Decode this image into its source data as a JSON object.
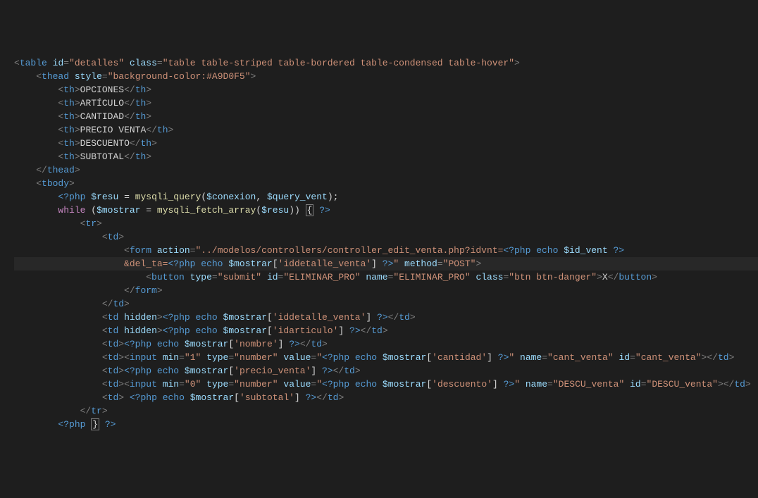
{
  "lines": [
    [
      [
        "tag-bracket",
        "<"
      ],
      [
        "tag-name",
        "table"
      ],
      [
        "text",
        " "
      ],
      [
        "attr-name",
        "id"
      ],
      [
        "tag-bracket",
        "="
      ],
      [
        "attr-value",
        "\"detalles\""
      ],
      [
        "text",
        " "
      ],
      [
        "attr-name",
        "class"
      ],
      [
        "tag-bracket",
        "="
      ],
      [
        "attr-value",
        "\"table table-striped table-bordered table-condensed table-hover\""
      ],
      [
        "tag-bracket",
        ">"
      ]
    ],
    [
      [
        "text",
        "    "
      ],
      [
        "tag-bracket",
        "<"
      ],
      [
        "tag-name",
        "thead"
      ],
      [
        "text",
        " "
      ],
      [
        "attr-name",
        "style"
      ],
      [
        "tag-bracket",
        "="
      ],
      [
        "attr-value",
        "\"background-color:#A9D0F5\""
      ],
      [
        "tag-bracket",
        ">"
      ]
    ],
    [
      [
        "text",
        "        "
      ],
      [
        "tag-bracket",
        "<"
      ],
      [
        "tag-name",
        "th"
      ],
      [
        "tag-bracket",
        ">"
      ],
      [
        "text",
        "OPCIONES"
      ],
      [
        "tag-bracket",
        "</"
      ],
      [
        "tag-name",
        "th"
      ],
      [
        "tag-bracket",
        ">"
      ]
    ],
    [
      [
        "text",
        "        "
      ],
      [
        "tag-bracket",
        "<"
      ],
      [
        "tag-name",
        "th"
      ],
      [
        "tag-bracket",
        ">"
      ],
      [
        "text",
        "ARTÍCULO"
      ],
      [
        "tag-bracket",
        "</"
      ],
      [
        "tag-name",
        "th"
      ],
      [
        "tag-bracket",
        ">"
      ]
    ],
    [
      [
        "text",
        "        "
      ],
      [
        "tag-bracket",
        "<"
      ],
      [
        "tag-name",
        "th"
      ],
      [
        "tag-bracket",
        ">"
      ],
      [
        "text",
        "CANTIDAD"
      ],
      [
        "tag-bracket",
        "</"
      ],
      [
        "tag-name",
        "th"
      ],
      [
        "tag-bracket",
        ">"
      ]
    ],
    [
      [
        "text",
        "        "
      ],
      [
        "tag-bracket",
        "<"
      ],
      [
        "tag-name",
        "th"
      ],
      [
        "tag-bracket",
        ">"
      ],
      [
        "text",
        "PRECIO VENTA"
      ],
      [
        "tag-bracket",
        "</"
      ],
      [
        "tag-name",
        "th"
      ],
      [
        "tag-bracket",
        ">"
      ]
    ],
    [
      [
        "text",
        "        "
      ],
      [
        "tag-bracket",
        "<"
      ],
      [
        "tag-name",
        "th"
      ],
      [
        "tag-bracket",
        ">"
      ],
      [
        "text",
        "DESCUENTO"
      ],
      [
        "tag-bracket",
        "</"
      ],
      [
        "tag-name",
        "th"
      ],
      [
        "tag-bracket",
        ">"
      ]
    ],
    [
      [
        "text",
        "        "
      ],
      [
        "tag-bracket",
        "<"
      ],
      [
        "tag-name",
        "th"
      ],
      [
        "tag-bracket",
        ">"
      ],
      [
        "text",
        "SUBTOTAL"
      ],
      [
        "tag-bracket",
        "</"
      ],
      [
        "tag-name",
        "th"
      ],
      [
        "tag-bracket",
        ">"
      ]
    ],
    [
      [
        "text",
        "    "
      ],
      [
        "tag-bracket",
        "</"
      ],
      [
        "tag-name",
        "thead"
      ],
      [
        "tag-bracket",
        ">"
      ]
    ],
    [
      [
        "text",
        "    "
      ],
      [
        "tag-bracket",
        "<"
      ],
      [
        "tag-name",
        "tbody"
      ],
      [
        "tag-bracket",
        ">"
      ]
    ],
    [
      [
        "text",
        "        "
      ],
      [
        "php-tag",
        "<?php"
      ],
      [
        "text",
        " "
      ],
      [
        "php-var",
        "$resu"
      ],
      [
        "text",
        " "
      ],
      [
        "php-op",
        "="
      ],
      [
        "text",
        " "
      ],
      [
        "php-fn",
        "mysqli_query"
      ],
      [
        "php-op",
        "("
      ],
      [
        "php-var",
        "$conexion"
      ],
      [
        "php-op",
        ","
      ],
      [
        "text",
        " "
      ],
      [
        "php-var",
        "$query_vent"
      ],
      [
        "php-op",
        ")"
      ],
      [
        "php-op",
        ";"
      ]
    ],
    [
      [
        "text",
        "        "
      ],
      [
        "php-kw",
        "while"
      ],
      [
        "text",
        " "
      ],
      [
        "php-op",
        "("
      ],
      [
        "php-var",
        "$mostrar"
      ],
      [
        "text",
        " "
      ],
      [
        "php-op",
        "="
      ],
      [
        "text",
        " "
      ],
      [
        "php-fn",
        "mysqli_fetch_array"
      ],
      [
        "php-op",
        "("
      ],
      [
        "php-var",
        "$resu"
      ],
      [
        "php-op",
        "))"
      ],
      [
        "text",
        " "
      ],
      [
        "brace-box",
        "{"
      ],
      [
        "text",
        " "
      ],
      [
        "php-tag",
        "?>"
      ]
    ],
    [
      [
        "text",
        "            "
      ],
      [
        "tag-bracket",
        "<"
      ],
      [
        "tag-name",
        "tr"
      ],
      [
        "tag-bracket",
        ">"
      ]
    ],
    [
      [
        "text",
        "                "
      ],
      [
        "tag-bracket",
        "<"
      ],
      [
        "tag-name",
        "td"
      ],
      [
        "tag-bracket",
        ">"
      ]
    ],
    [
      [
        "text",
        "                    "
      ],
      [
        "tag-bracket",
        "<"
      ],
      [
        "tag-name",
        "form"
      ],
      [
        "text",
        " "
      ],
      [
        "attr-name",
        "action"
      ],
      [
        "tag-bracket",
        "="
      ],
      [
        "attr-value",
        "\"../modelos/controllers/controller_edit_venta.php?idvnt="
      ],
      [
        "php-tag",
        "<?php"
      ],
      [
        "text",
        " "
      ],
      [
        "php-kw2",
        "echo"
      ],
      [
        "text",
        " "
      ],
      [
        "php-var",
        "$id_vent"
      ],
      [
        "text",
        " "
      ],
      [
        "php-tag",
        "?>"
      ]
    ],
    [
      [
        "text",
        "                    "
      ],
      [
        "attr-value",
        "&del_ta="
      ],
      [
        "php-tag",
        "<?php"
      ],
      [
        "text",
        " "
      ],
      [
        "php-kw2",
        "echo"
      ],
      [
        "text",
        " "
      ],
      [
        "php-var",
        "$mostrar"
      ],
      [
        "php-op",
        "["
      ],
      [
        "php-str",
        "'iddetalle_venta'"
      ],
      [
        "php-op",
        "]"
      ],
      [
        "text",
        " "
      ],
      [
        "php-tag",
        "?>"
      ],
      [
        "attr-value",
        "\""
      ],
      [
        "text",
        " "
      ],
      [
        "attr-name",
        "method"
      ],
      [
        "tag-bracket",
        "="
      ],
      [
        "attr-value",
        "\"POST\""
      ],
      [
        "tag-bracket",
        ">"
      ]
    ],
    [
      [
        "text",
        "                        "
      ],
      [
        "tag-bracket",
        "<"
      ],
      [
        "tag-name",
        "button"
      ],
      [
        "text",
        " "
      ],
      [
        "attr-name",
        "type"
      ],
      [
        "tag-bracket",
        "="
      ],
      [
        "attr-value",
        "\"submit\""
      ],
      [
        "text",
        " "
      ],
      [
        "attr-name",
        "id"
      ],
      [
        "tag-bracket",
        "="
      ],
      [
        "attr-value",
        "\"ELIMINAR_PRO\""
      ],
      [
        "text",
        " "
      ],
      [
        "attr-name",
        "name"
      ],
      [
        "tag-bracket",
        "="
      ],
      [
        "attr-value",
        "\"ELIMINAR_PRO\""
      ],
      [
        "text",
        " "
      ],
      [
        "attr-name",
        "class"
      ],
      [
        "tag-bracket",
        "="
      ],
      [
        "attr-value",
        "\"btn btn-danger\""
      ],
      [
        "tag-bracket",
        ">"
      ],
      [
        "text",
        "X"
      ],
      [
        "tag-bracket",
        "</"
      ],
      [
        "tag-name",
        "button"
      ],
      [
        "tag-bracket",
        ">"
      ]
    ],
    [
      [
        "text",
        "                    "
      ],
      [
        "tag-bracket",
        "</"
      ],
      [
        "tag-name",
        "form"
      ],
      [
        "tag-bracket",
        ">"
      ]
    ],
    [
      [
        "text",
        "                "
      ],
      [
        "tag-bracket",
        "</"
      ],
      [
        "tag-name",
        "td"
      ],
      [
        "tag-bracket",
        ">"
      ]
    ],
    [
      [
        "text",
        "                "
      ],
      [
        "tag-bracket",
        "<"
      ],
      [
        "tag-name",
        "td"
      ],
      [
        "text",
        " "
      ],
      [
        "attr-name",
        "hidden"
      ],
      [
        "tag-bracket",
        ">"
      ],
      [
        "php-tag",
        "<?php"
      ],
      [
        "text",
        " "
      ],
      [
        "php-kw2",
        "echo"
      ],
      [
        "text",
        " "
      ],
      [
        "php-var",
        "$mostrar"
      ],
      [
        "php-op",
        "["
      ],
      [
        "php-str",
        "'iddetalle_venta'"
      ],
      [
        "php-op",
        "]"
      ],
      [
        "text",
        " "
      ],
      [
        "php-tag",
        "?>"
      ],
      [
        "tag-bracket",
        "</"
      ],
      [
        "tag-name",
        "td"
      ],
      [
        "tag-bracket",
        ">"
      ]
    ],
    [
      [
        "text",
        "                "
      ],
      [
        "tag-bracket",
        "<"
      ],
      [
        "tag-name",
        "td"
      ],
      [
        "text",
        " "
      ],
      [
        "attr-name",
        "hidden"
      ],
      [
        "tag-bracket",
        ">"
      ],
      [
        "php-tag",
        "<?php"
      ],
      [
        "text",
        " "
      ],
      [
        "php-kw2",
        "echo"
      ],
      [
        "text",
        " "
      ],
      [
        "php-var",
        "$mostrar"
      ],
      [
        "php-op",
        "["
      ],
      [
        "php-str",
        "'idarticulo'"
      ],
      [
        "php-op",
        "]"
      ],
      [
        "text",
        " "
      ],
      [
        "php-tag",
        "?>"
      ],
      [
        "tag-bracket",
        "</"
      ],
      [
        "tag-name",
        "td"
      ],
      [
        "tag-bracket",
        ">"
      ]
    ],
    [
      [
        "text",
        "                "
      ],
      [
        "tag-bracket",
        "<"
      ],
      [
        "tag-name",
        "td"
      ],
      [
        "tag-bracket",
        ">"
      ],
      [
        "php-tag",
        "<?php"
      ],
      [
        "text",
        " "
      ],
      [
        "php-kw2",
        "echo"
      ],
      [
        "text",
        " "
      ],
      [
        "php-var",
        "$mostrar"
      ],
      [
        "php-op",
        "["
      ],
      [
        "php-str",
        "'nombre'"
      ],
      [
        "php-op",
        "]"
      ],
      [
        "text",
        " "
      ],
      [
        "php-tag",
        "?>"
      ],
      [
        "tag-bracket",
        "</"
      ],
      [
        "tag-name",
        "td"
      ],
      [
        "tag-bracket",
        ">"
      ]
    ],
    [
      [
        "text",
        "                "
      ],
      [
        "tag-bracket",
        "<"
      ],
      [
        "tag-name",
        "td"
      ],
      [
        "tag-bracket",
        ">"
      ],
      [
        "tag-bracket",
        "<"
      ],
      [
        "tag-name",
        "input"
      ],
      [
        "text",
        " "
      ],
      [
        "attr-name",
        "min"
      ],
      [
        "tag-bracket",
        "="
      ],
      [
        "attr-value",
        "\"1\""
      ],
      [
        "text",
        " "
      ],
      [
        "attr-name",
        "type"
      ],
      [
        "tag-bracket",
        "="
      ],
      [
        "attr-value",
        "\"number\""
      ],
      [
        "text",
        " "
      ],
      [
        "attr-name",
        "value"
      ],
      [
        "tag-bracket",
        "="
      ],
      [
        "attr-value",
        "\""
      ],
      [
        "php-tag",
        "<?php"
      ],
      [
        "text",
        " "
      ],
      [
        "php-kw2",
        "echo"
      ],
      [
        "text",
        " "
      ],
      [
        "php-var",
        "$mostrar"
      ],
      [
        "php-op",
        "["
      ],
      [
        "php-str",
        "'cantidad'"
      ],
      [
        "php-op",
        "]"
      ],
      [
        "text",
        " "
      ],
      [
        "php-tag",
        "?>"
      ],
      [
        "attr-value",
        "\""
      ],
      [
        "text",
        " "
      ],
      [
        "attr-name",
        "name"
      ],
      [
        "tag-bracket",
        "="
      ],
      [
        "attr-value",
        "\"cant_venta\""
      ],
      [
        "text",
        " "
      ],
      [
        "attr-name",
        "id"
      ],
      [
        "tag-bracket",
        "="
      ],
      [
        "attr-value",
        "\"cant_venta\""
      ],
      [
        "tag-bracket",
        ">"
      ],
      [
        "tag-bracket",
        "</"
      ],
      [
        "tag-name",
        "td"
      ],
      [
        "tag-bracket",
        ">"
      ]
    ],
    [
      [
        "text",
        "                "
      ],
      [
        "tag-bracket",
        "<"
      ],
      [
        "tag-name",
        "td"
      ],
      [
        "tag-bracket",
        ">"
      ],
      [
        "php-tag",
        "<?php"
      ],
      [
        "text",
        " "
      ],
      [
        "php-kw2",
        "echo"
      ],
      [
        "text",
        " "
      ],
      [
        "php-var",
        "$mostrar"
      ],
      [
        "php-op",
        "["
      ],
      [
        "php-str",
        "'precio_venta'"
      ],
      [
        "php-op",
        "]"
      ],
      [
        "text",
        " "
      ],
      [
        "php-tag",
        "?>"
      ],
      [
        "tag-bracket",
        "</"
      ],
      [
        "tag-name",
        "td"
      ],
      [
        "tag-bracket",
        ">"
      ]
    ],
    [
      [
        "text",
        "                "
      ],
      [
        "tag-bracket",
        "<"
      ],
      [
        "tag-name",
        "td"
      ],
      [
        "tag-bracket",
        ">"
      ],
      [
        "tag-bracket",
        "<"
      ],
      [
        "tag-name",
        "input"
      ],
      [
        "text",
        " "
      ],
      [
        "attr-name",
        "min"
      ],
      [
        "tag-bracket",
        "="
      ],
      [
        "attr-value",
        "\"0\""
      ],
      [
        "text",
        " "
      ],
      [
        "attr-name",
        "type"
      ],
      [
        "tag-bracket",
        "="
      ],
      [
        "attr-value",
        "\"number\""
      ],
      [
        "text",
        " "
      ],
      [
        "attr-name",
        "value"
      ],
      [
        "tag-bracket",
        "="
      ],
      [
        "attr-value",
        "\""
      ],
      [
        "php-tag",
        "<?php"
      ],
      [
        "text",
        " "
      ],
      [
        "php-kw2",
        "echo"
      ],
      [
        "text",
        " "
      ],
      [
        "php-var",
        "$mostrar"
      ],
      [
        "php-op",
        "["
      ],
      [
        "php-str",
        "'descuento'"
      ],
      [
        "php-op",
        "]"
      ],
      [
        "text",
        " "
      ],
      [
        "php-tag",
        "?>"
      ],
      [
        "attr-value",
        "\""
      ],
      [
        "text",
        " "
      ],
      [
        "attr-name",
        "name"
      ],
      [
        "tag-bracket",
        "="
      ],
      [
        "attr-value",
        "\"DESCU_venta\""
      ],
      [
        "text",
        " "
      ],
      [
        "attr-name",
        "id"
      ],
      [
        "tag-bracket",
        "="
      ],
      [
        "attr-value",
        "\"DESCU_venta\""
      ],
      [
        "tag-bracket",
        ">"
      ],
      [
        "tag-bracket",
        "</"
      ],
      [
        "tag-name",
        "td"
      ],
      [
        "tag-bracket",
        ">"
      ]
    ],
    [
      [
        "text",
        "                "
      ],
      [
        "tag-bracket",
        "<"
      ],
      [
        "tag-name",
        "td"
      ],
      [
        "tag-bracket",
        ">"
      ],
      [
        "text",
        " "
      ],
      [
        "php-tag",
        "<?php"
      ],
      [
        "text",
        " "
      ],
      [
        "php-kw2",
        "echo"
      ],
      [
        "text",
        " "
      ],
      [
        "php-var",
        "$mostrar"
      ],
      [
        "php-op",
        "["
      ],
      [
        "php-str",
        "'subtotal'"
      ],
      [
        "php-op",
        "]"
      ],
      [
        "text",
        " "
      ],
      [
        "php-tag",
        "?>"
      ],
      [
        "tag-bracket",
        "</"
      ],
      [
        "tag-name",
        "td"
      ],
      [
        "tag-bracket",
        ">"
      ]
    ],
    [
      [
        "text",
        "            "
      ],
      [
        "tag-bracket",
        "</"
      ],
      [
        "tag-name",
        "tr"
      ],
      [
        "tag-bracket",
        ">"
      ]
    ],
    [
      [
        "text",
        ""
      ]
    ],
    [
      [
        "text",
        "        "
      ],
      [
        "php-tag",
        "<?php"
      ],
      [
        "text",
        " "
      ],
      [
        "brace-box",
        "}"
      ],
      [
        "text",
        " "
      ],
      [
        "php-tag",
        "?>"
      ]
    ]
  ],
  "currentLineIndex": 15
}
